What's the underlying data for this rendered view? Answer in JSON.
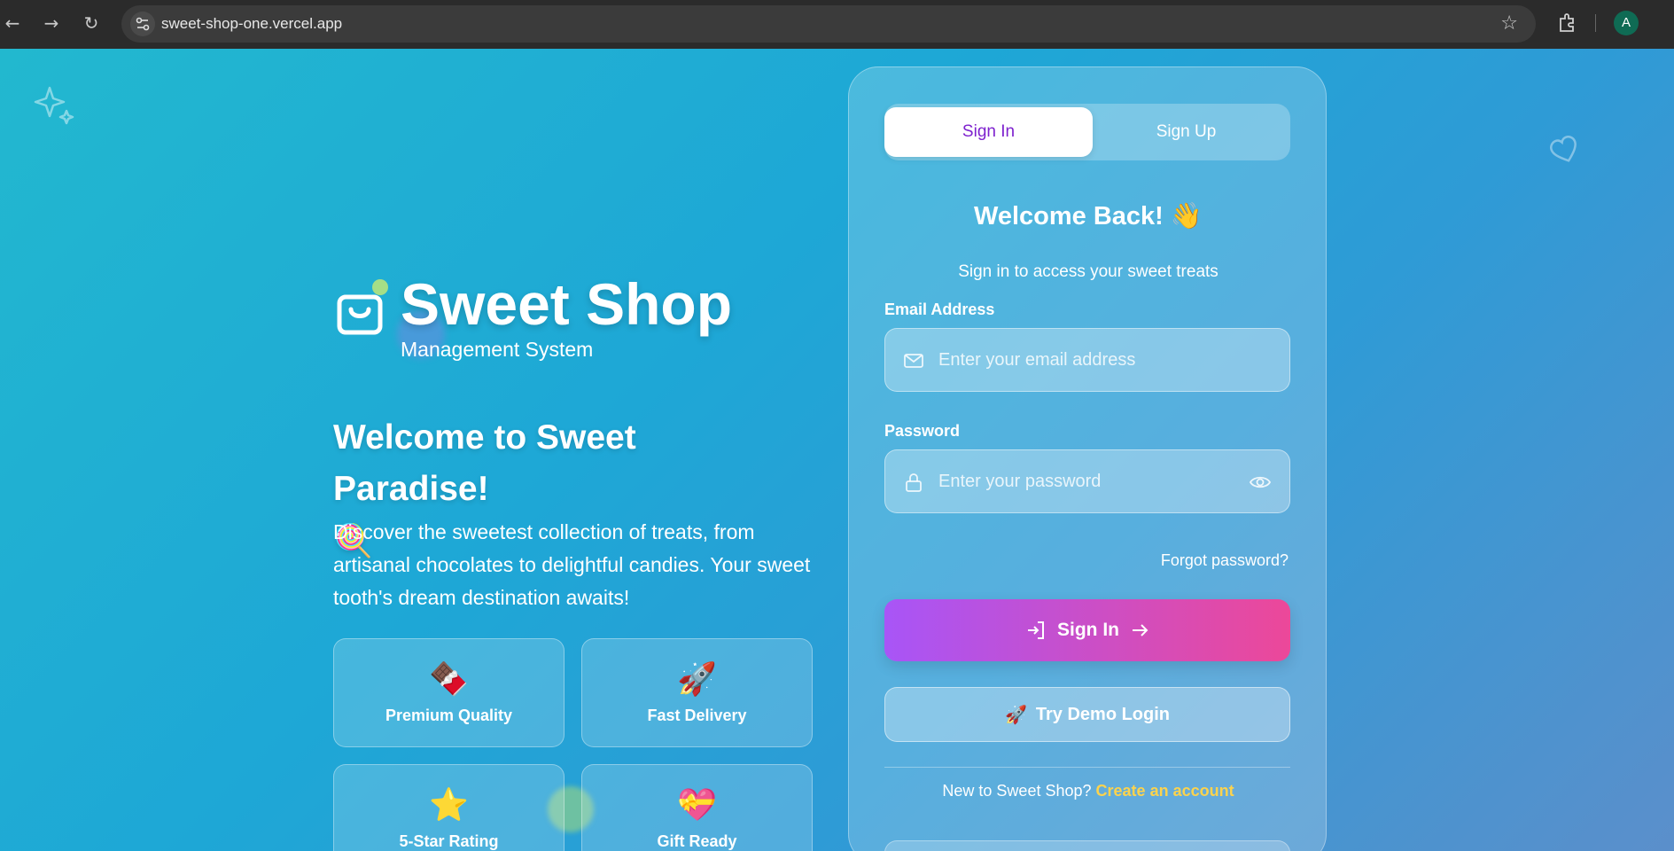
{
  "browser": {
    "url": "sweet-shop-one.vercel.app",
    "profile_initial": "A"
  },
  "brand": {
    "title": "Sweet Shop",
    "subtitle": "Management System"
  },
  "hero": {
    "title": "Welcome to Sweet Paradise!",
    "title_emoji": "🍭",
    "description": "Discover the sweetest collection of treats, from artisanal chocolates to delightful candies. Your sweet tooth's dream destination awaits!"
  },
  "features": [
    {
      "emoji": "🍫",
      "label": "Premium Quality"
    },
    {
      "emoji": "🚀",
      "label": "Fast Delivery"
    },
    {
      "emoji": "⭐",
      "label": "5-Star Rating"
    },
    {
      "emoji": "💝",
      "label": "Gift Ready"
    }
  ],
  "auth": {
    "tabs": [
      "Sign In",
      "Sign Up"
    ],
    "active_tab": "Sign In",
    "heading": "Welcome Back!",
    "heading_emoji": "👋",
    "subheading": "Sign in to access your sweet treats",
    "email_label": "Email Address",
    "email_placeholder": "Enter your email address",
    "email_value": "",
    "password_label": "Password",
    "password_placeholder": "Enter your password",
    "password_value": "",
    "forgot": "Forgot password?",
    "signin_button": "Sign In",
    "demo_emoji": "🚀",
    "demo_button": "Try Demo Login",
    "signup_prompt": "New to Sweet Shop?",
    "signup_link": "Create an account"
  },
  "colors": {
    "accent_purple": "#a855f7",
    "accent_pink": "#ec4899",
    "link_yellow": "#fcd34d",
    "active_tab_text": "#7e22ce"
  },
  "icons": [
    "back-icon",
    "forward-icon",
    "reload-icon",
    "site-settings-icon",
    "bookmark-star-icon",
    "extensions-icon",
    "sparkle-icon",
    "heart-icon",
    "shopping-bag-icon",
    "mail-icon",
    "lock-icon",
    "eye-icon",
    "login-icon",
    "arrow-right-icon"
  ]
}
